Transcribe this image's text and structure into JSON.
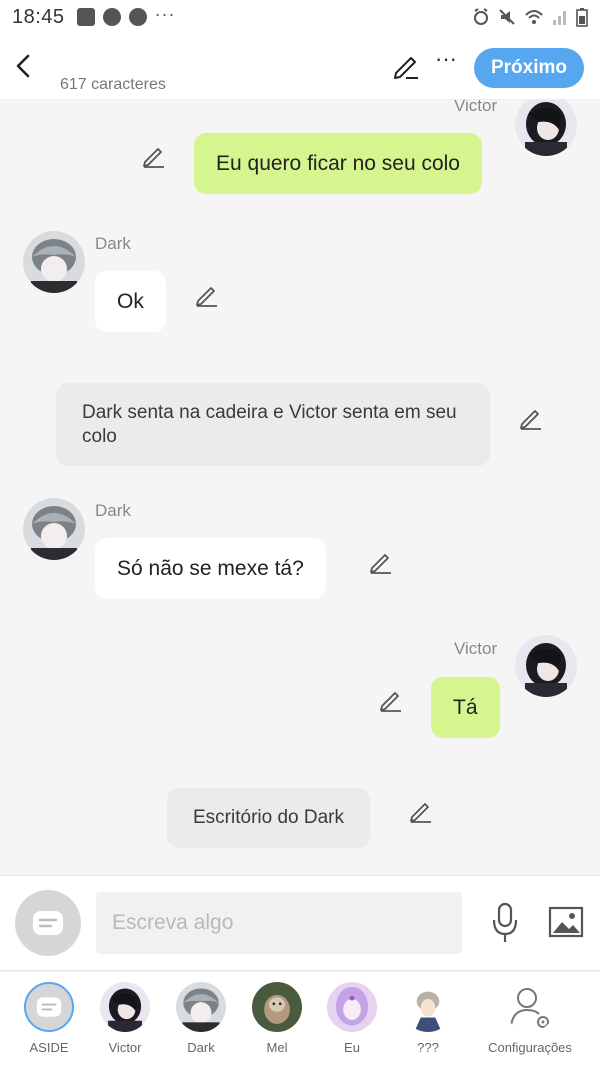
{
  "status_bar": {
    "time": "18:45",
    "left_icons": [
      "gallery-icon",
      "chrome-icon",
      "chrome-icon",
      "more-dots-icon"
    ],
    "right_icons": [
      "alarm-icon",
      "mute-icon",
      "wifi-icon",
      "signal-icon",
      "battery-icon"
    ]
  },
  "header": {
    "char_count": "617 caracteres",
    "next_label": "Próximo",
    "more_label": "···"
  },
  "messages": [
    {
      "type": "outgoing",
      "speaker": "Victor",
      "text": "Eu quero ficar no seu colo"
    },
    {
      "type": "incoming",
      "speaker": "Dark",
      "text": "Ok"
    },
    {
      "type": "narration",
      "text": "Dark senta na cadeira e Victor senta em seu colo"
    },
    {
      "type": "incoming",
      "speaker": "Dark",
      "text": "Só não se mexe tá?"
    },
    {
      "type": "outgoing",
      "speaker": "Victor",
      "text": "Tá"
    },
    {
      "type": "narration",
      "text": "Escritório do Dark"
    }
  ],
  "composer": {
    "placeholder": "Escreva algo"
  },
  "characters": [
    {
      "name": "ASIDE",
      "active": true
    },
    {
      "name": "Victor"
    },
    {
      "name": "Dark"
    },
    {
      "name": "Mel"
    },
    {
      "name": "Eu"
    },
    {
      "name": "???"
    },
    {
      "name": "Configurações"
    }
  ],
  "colors": {
    "accent": "#56a7f0",
    "outgoing_bubble": "#d5f58f",
    "incoming_bubble": "#ffffff",
    "narration_bubble": "#ebebeb",
    "background": "#f5f5f5"
  }
}
